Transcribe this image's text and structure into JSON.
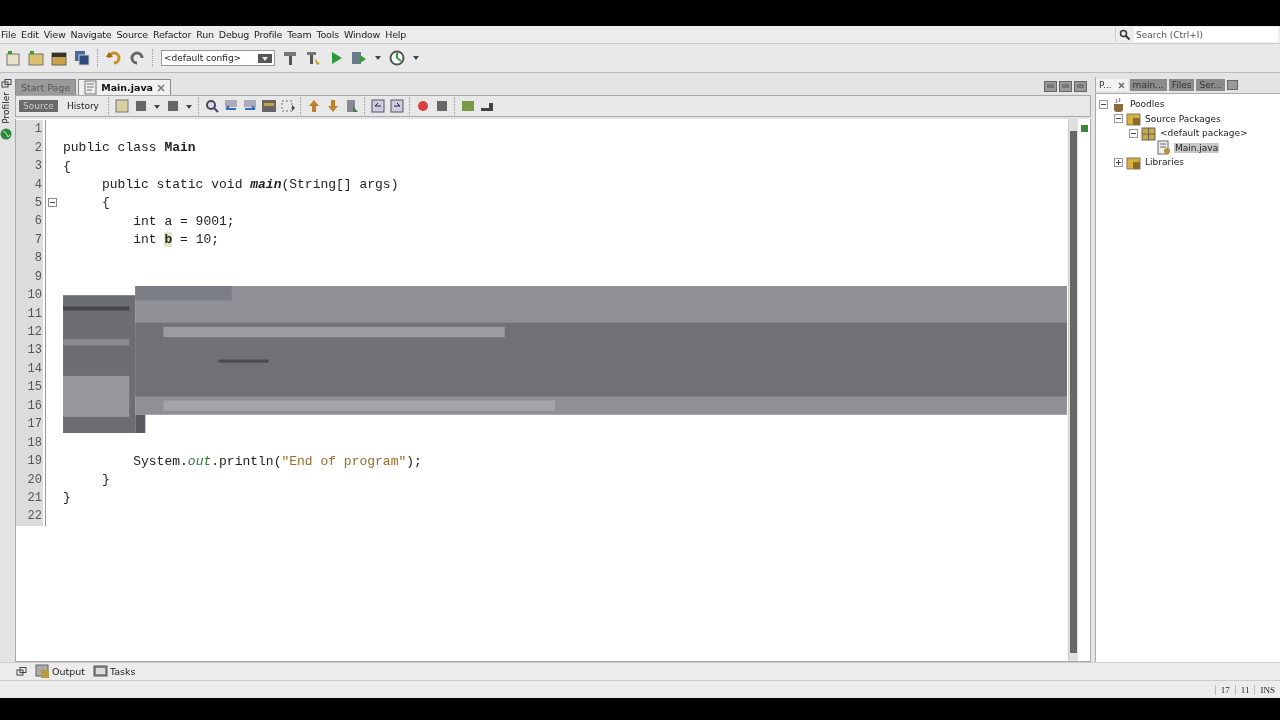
{
  "menu": [
    "File",
    "Edit",
    "View",
    "Navigate",
    "Source",
    "Refactor",
    "Run",
    "Debug",
    "Profile",
    "Team",
    "Tools",
    "Window",
    "Help"
  ],
  "search": {
    "placeholder": "Search (Ctrl+I)"
  },
  "toolbar": {
    "config": "<default config>"
  },
  "side_strip": {
    "label": "Profiler"
  },
  "editor_tabs": [
    {
      "label": "Start Page",
      "selected": false,
      "closable": false
    },
    {
      "label": "Main.java",
      "selected": true,
      "closable": true
    }
  ],
  "view_tabs": [
    {
      "label": "Source",
      "selected": true
    },
    {
      "label": "History",
      "selected": false
    }
  ],
  "lines": [
    {
      "number": "1",
      "kind": "code",
      "fold": false
    },
    {
      "number": "2",
      "kind": "code",
      "fold": false,
      "segments": [
        {
          "text": "public class ",
          "kind": "plain"
        },
        {
          "text": "Main",
          "kind": "bold"
        }
      ]
    },
    {
      "number": "3",
      "kind": "code",
      "fold": false,
      "segments": [
        {
          "text": "{",
          "kind": "plain"
        }
      ]
    },
    {
      "number": "4",
      "kind": "code",
      "fold": false,
      "segments": [
        {
          "text": "     public static void ",
          "kind": "plain"
        },
        {
          "text": "main",
          "kind": "method"
        },
        {
          "text": "(String[] args)",
          "kind": "plain"
        }
      ]
    },
    {
      "number": "5",
      "kind": "code",
      "fold": true,
      "segments": [
        {
          "text": "     {",
          "kind": "plain"
        }
      ]
    },
    {
      "number": "6",
      "kind": "code",
      "fold": false,
      "segments": [
        {
          "text": "         int a = 9001;",
          "kind": "plain"
        }
      ]
    },
    {
      "number": "7",
      "kind": "code",
      "fold": false,
      "segments": [
        {
          "text": "         int ",
          "kind": "plain"
        },
        {
          "text": "b",
          "kind": "occurrence"
        },
        {
          "text": " = 10;",
          "kind": "plain"
        }
      ]
    },
    {
      "number": "8",
      "kind": "code",
      "fold": false
    },
    {
      "number": "9",
      "kind": "code",
      "fold": false
    },
    {
      "number": "10",
      "kind": "glitched",
      "fold": false
    },
    {
      "number": "11",
      "kind": "glitched",
      "fold": false
    },
    {
      "number": "12",
      "kind": "glitched",
      "fold": false
    },
    {
      "number": "13",
      "kind": "glitched",
      "fold": false
    },
    {
      "number": "14",
      "kind": "glitched",
      "fold": false
    },
    {
      "number": "15",
      "kind": "glitched",
      "fold": false
    },
    {
      "number": "16",
      "kind": "glitched",
      "fold": false
    },
    {
      "number": "17",
      "kind": "glitched",
      "fold": false
    },
    {
      "number": "18",
      "kind": "code",
      "fold": false
    },
    {
      "number": "19",
      "kind": "code",
      "fold": false,
      "segments": [
        {
          "text": "         System.",
          "kind": "plain"
        },
        {
          "text": "out",
          "kind": "field"
        },
        {
          "text": ".println(",
          "kind": "plain"
        },
        {
          "text": "\"End of program\"",
          "kind": "string"
        },
        {
          "text": ");",
          "kind": "plain"
        }
      ]
    },
    {
      "number": "20",
      "kind": "code",
      "fold": false,
      "segments": [
        {
          "text": "     }",
          "kind": "plain"
        }
      ]
    },
    {
      "number": "21",
      "kind": "code",
      "fold": false,
      "segments": [
        {
          "text": "}",
          "kind": "plain"
        }
      ]
    },
    {
      "number": "22",
      "kind": "code",
      "fold": false
    }
  ],
  "project_tabs": [
    {
      "label": "P...",
      "selected": true,
      "closable": true
    },
    {
      "label": "main...",
      "selected": false,
      "closable": false
    },
    {
      "label": "Files",
      "selected": false,
      "closable": false
    },
    {
      "label": "Ser...",
      "selected": false,
      "closable": false
    }
  ],
  "tree": [
    {
      "label": "Poodles",
      "kind": "project",
      "expanded": true,
      "selected": false,
      "children": [
        {
          "label": "Source Packages",
          "kind": "folder",
          "expanded": true,
          "selected": false,
          "children": [
            {
              "label": "<default package>",
              "kind": "package",
              "expanded": true,
              "selected": false,
              "children": [
                {
                  "label": "Main.java",
                  "kind": "file",
                  "selected": true
                }
              ]
            }
          ]
        },
        {
          "label": "Libraries",
          "kind": "folder",
          "expanded": false,
          "selected": false
        }
      ]
    }
  ],
  "bottom_tabs": [
    {
      "label": "Output",
      "kind": "output"
    },
    {
      "label": "Tasks",
      "kind": "tasks"
    }
  ],
  "status_bar": {
    "line": "17",
    "column": "11",
    "mode": "INS"
  }
}
